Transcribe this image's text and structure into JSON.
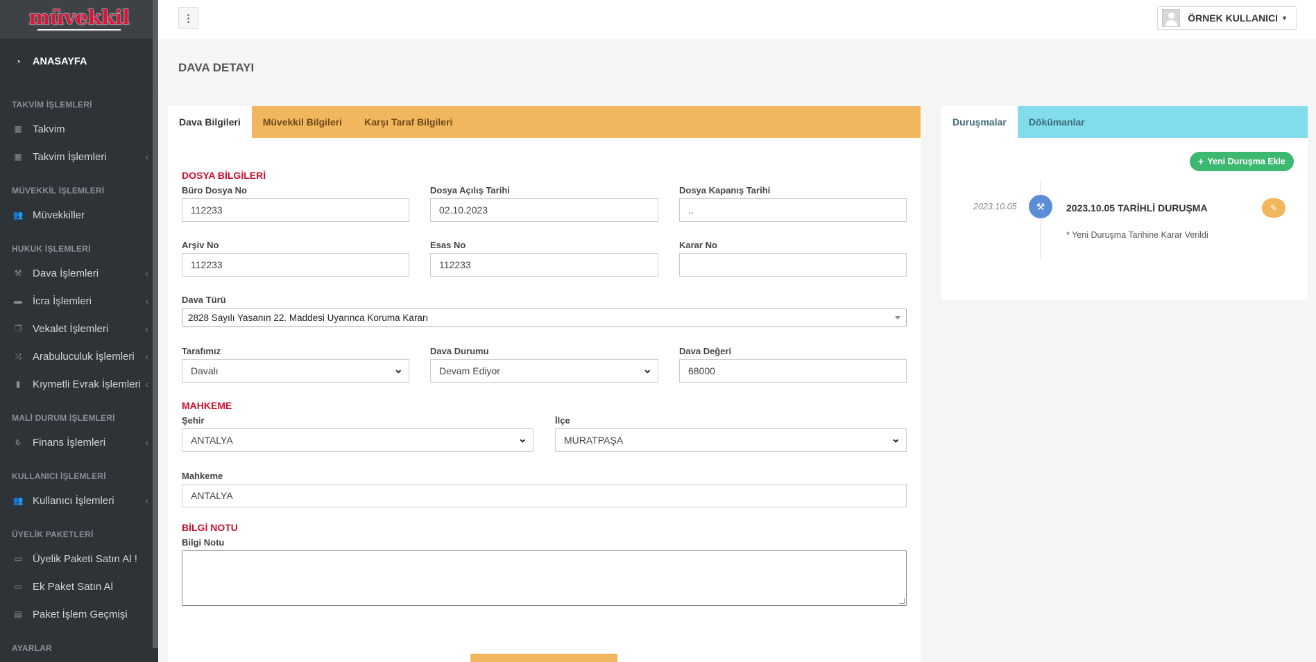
{
  "logo": {
    "text": "müvekkil"
  },
  "sidebar": {
    "home": "ANASAYFA",
    "sections": [
      {
        "header": "TAKVİM İŞLEMLERİ",
        "items": [
          {
            "label": "Takvim"
          },
          {
            "label": "Takvim İşlemleri"
          }
        ]
      },
      {
        "header": "MÜVEKKİL İŞLEMLERİ",
        "items": [
          {
            "label": "Müvekkiller"
          }
        ]
      },
      {
        "header": "HUKUK İŞLEMLERİ",
        "items": [
          {
            "label": "Dava İşlemleri"
          },
          {
            "label": "İcra İşlemleri"
          },
          {
            "label": "Vekalet İşlemleri"
          },
          {
            "label": "Arabuluculuk İşlemleri"
          },
          {
            "label": "Kıymetli Evrak İşlemleri"
          }
        ]
      },
      {
        "header": "MALİ DURUM İŞLEMLERİ",
        "items": [
          {
            "label": "Finans İşlemleri"
          }
        ]
      },
      {
        "header": "KULLANICI İŞLEMLERİ",
        "items": [
          {
            "label": "Kullanıcı İşlemleri"
          }
        ]
      },
      {
        "header": "ÜYELİK PAKETLERİ",
        "items": [
          {
            "label": "Üyelik Paketi Satın Al !"
          },
          {
            "label": "Ek Paket Satın Al"
          },
          {
            "label": "Paket İşlem Geçmişi"
          }
        ]
      },
      {
        "header": "AYARLAR"
      }
    ]
  },
  "topbar": {
    "menu_icon": "⋮",
    "user_name": "ÖRNEK KULLANICI"
  },
  "page": {
    "title": "DAVA DETAYI"
  },
  "tabs_left": {
    "t1": "Dava Bilgileri",
    "t2": "Müvekkil Bilgileri",
    "t3": "Karşı Taraf Bilgileri"
  },
  "form": {
    "section_file": "DOSYA BİLGİLERİ",
    "buro_dosya_no": {
      "label": "Büro Dosya No",
      "value": "112233"
    },
    "dosya_acilis": {
      "label": "Dosya Açılış Tarihi",
      "value": "02.10.2023"
    },
    "dosya_kapanis": {
      "label": "Dosya Kapanış Tarihi",
      "value": ".."
    },
    "arsiv_no": {
      "label": "Arşiv No",
      "value": "112233"
    },
    "esas_no": {
      "label": "Esas No",
      "value": "112233"
    },
    "karar_no": {
      "label": "Karar No",
      "value": ""
    },
    "dava_turu": {
      "label": "Dava Türü",
      "value": "2828 Sayılı Yasanın 22. Maddesi Uyarınca Koruma Kararı"
    },
    "tarafimiz": {
      "label": "Tarafımız",
      "value": "Davalı"
    },
    "dava_durumu": {
      "label": "Dava Durumu",
      "value": "Devam Ediyor"
    },
    "dava_degeri": {
      "label": "Dava Değeri",
      "value": "68000"
    },
    "section_court": "MAHKEME",
    "sehir": {
      "label": "Şehir",
      "value": "ANTALYA"
    },
    "ilce": {
      "label": "İlçe",
      "value": "MURATPAŞA"
    },
    "mahkeme": {
      "label": "Mahkeme",
      "value": "ANTALYA"
    },
    "section_note": "BİLGİ NOTU",
    "bilgi_notu": {
      "label": "Bilgi Notu",
      "value": ""
    }
  },
  "tabs_right": {
    "t1": "Duruşmalar",
    "t2": "Dökümanlar"
  },
  "hearings": {
    "add_label": "Yeni Duruşma Ekle",
    "item": {
      "date": "2023.10.05",
      "title": "2023.10.05 TARİHLİ DURUŞMA",
      "note": "* Yeni Duruşma Tarihine Karar Verildi"
    }
  }
}
